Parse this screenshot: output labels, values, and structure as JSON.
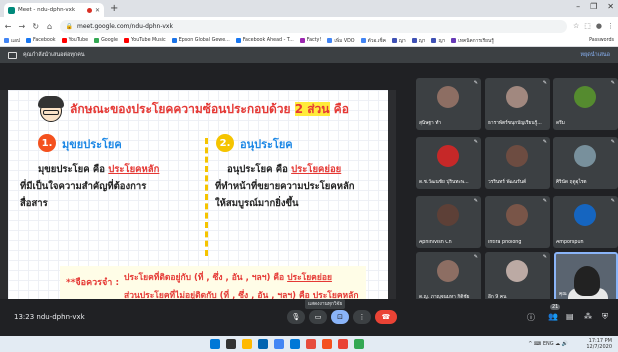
{
  "browser": {
    "tab_title": "Meet - ndu-dphn-vxk",
    "new_tab": "+",
    "url": "meet.google.com/ndu-dphn-vxk",
    "window_controls": [
      "–",
      "❐",
      "✕"
    ],
    "bookmarks": [
      {
        "label": "แอป",
        "color": "#4285f4"
      },
      {
        "label": "Facebook",
        "color": "#1877f2"
      },
      {
        "label": "YouTube",
        "color": "#ff0000"
      },
      {
        "label": "Google",
        "color": "#34a853"
      },
      {
        "label": "YouTube Music",
        "color": "#ff0000"
      },
      {
        "label": "Epson Global Gewe...",
        "color": "#1a73e8"
      },
      {
        "label": "Facebook Ahead - T...",
        "color": "#1877f2"
      },
      {
        "label": "Facty!",
        "color": "#9c27b0"
      },
      {
        "label": "เพิ่ม VDO",
        "color": "#4285f4"
      },
      {
        "label": "ตัวอ.เช็ค",
        "color": "#4285f4"
      },
      {
        "label": "ญา",
        "color": "#3f51b5"
      },
      {
        "label": "ญา",
        "color": "#3f51b5"
      },
      {
        "label": "ญา",
        "color": "#3f51b5"
      },
      {
        "label": "เทคนิคการเรียนรู้",
        "color": "#673ab7"
      }
    ],
    "bookmarks_other": "Passwords"
  },
  "meet": {
    "presenting_text": "คุณกำลังนำเสนอต่อทุกคน",
    "stop_presenting": "หยุดนำเสนอ",
    "meeting_code": "13:23   ndu-dphn-vxk",
    "tooltip": "แสดงงานทุกวิจัย",
    "participants_badge": "21"
  },
  "slide": {
    "title_pre": "ลักษณะของประโยคความซ้อนประกอบด้วย ",
    "title_hl": "2 ส่วน",
    "title_post": " คือ",
    "badge1": "1.",
    "badge2": "2.",
    "heading1": "มุขยประโยค",
    "heading2": "อนุประโยค",
    "left_l1_pre": "มุขยประโยค คือ ",
    "left_l1_link": "ประโยคหลัก",
    "left_l2": "ที่มีเป็นใจความสำคัญที่ต้องการ",
    "left_l3": "สื่อสาร",
    "right_l1_pre": "อนุประโยค คือ ",
    "right_l1_link": "ประโยคย่อย",
    "right_l2": "ที่ทำหน้าที่ขยายความประโยคหลัก",
    "right_l3": "ให้สมบูรณ์มากยิ่งขึ้น",
    "note_label": "**จือควรจำ :",
    "note1_pre": "ประโยคที่ติดอยู่กับ (ที่ , ซึ่ง , อัน , ฯลฯ) คือ ",
    "note1_link": "ประโยคย่อย",
    "note2_pre": "ส่วนประโยคที่ไม่อยู่ติดกับ (ที่ , ซึ่ง , อัน , ฯลฯ) คือ ",
    "note2_link": "ประโยคหลัก"
  },
  "participants": [
    {
      "name": "สุนิษฐา ทำ",
      "avatar_color": "#8d6e63",
      "letter": ""
    },
    {
      "name": "ธาราพัตร์ขนุกบัญเรียนรู้...",
      "avatar_color": "#a1887f",
      "letter": ""
    },
    {
      "name": "ดรีม",
      "avatar_color": "#558b2f",
      "letter": ""
    },
    {
      "name": "ด.ช.วัฒนชัย ปุรินทะพ...",
      "avatar_color": "#c62828",
      "letter": ""
    },
    {
      "name": "วรรินทร์ พัฒนรันต์",
      "avatar_color": "#6d4c41",
      "letter": ""
    },
    {
      "name": "ศิรินัด ฤดูอุไรต",
      "avatar_color": "#78909c",
      "letter": ""
    },
    {
      "name": "Aphinivish Ch",
      "avatar_color": "#5d4037",
      "letter": ""
    },
    {
      "name": "intira pholong",
      "avatar_color": "#795548",
      "letter": ""
    },
    {
      "name": "Amporspun",
      "avatar_color": "#1565c0",
      "letter": ""
    },
    {
      "name": "ด.ญ. ภาญุจนมหา กิติชัย",
      "avatar_color": "#8d6e63",
      "letter": ""
    },
    {
      "name": "อีก 9 คน",
      "avatar_color": "#bcaaa4",
      "letter": ""
    }
  ],
  "self_tile": {
    "name": "คุณ"
  },
  "taskbar": {
    "icons": [
      "#0078d7",
      "#333333",
      "#ffb900",
      "#0063b1",
      "#4285f4",
      "#0078d7",
      "#e74c3c",
      "#f4511e",
      "#ea4335",
      "#34a853"
    ],
    "tray_icons": "^ ⌨ ENG ☁ 🔊",
    "time": "17:17 PM",
    "date": "12/7/2020"
  }
}
